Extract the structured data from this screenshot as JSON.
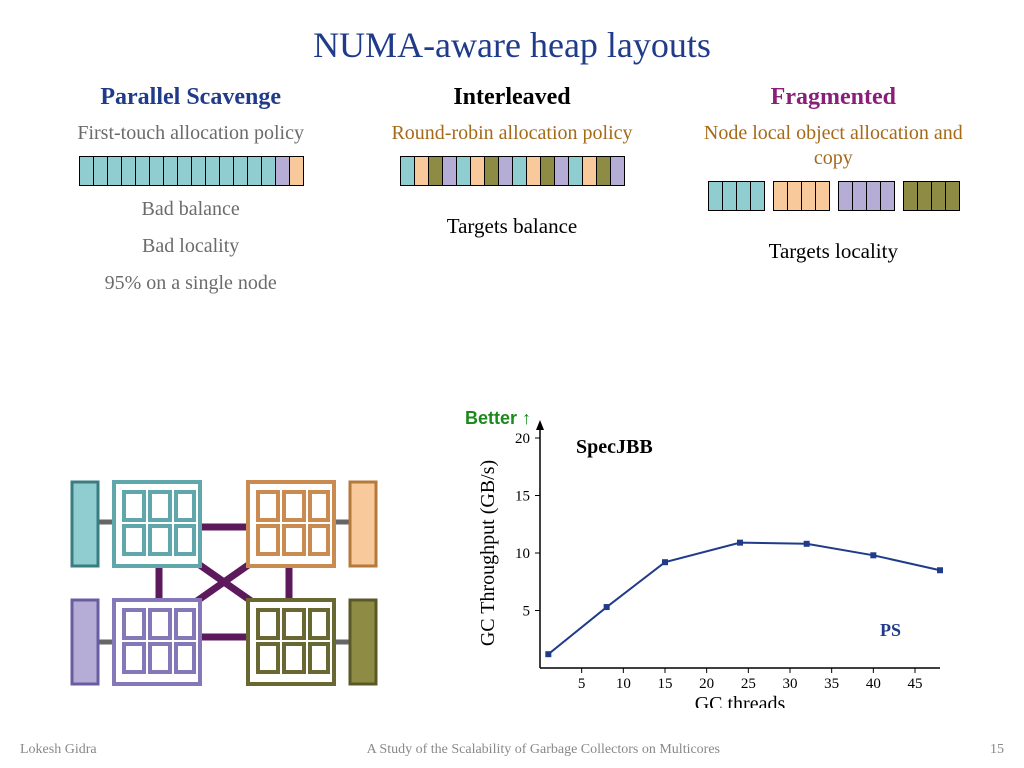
{
  "title": "NUMA-aware heap layouts",
  "columns": {
    "ps": {
      "title": "Parallel Scavenge",
      "title_color": "#1f3b8a",
      "sub": "First-touch allocation policy",
      "sub_color": "#6b6b6b",
      "notes": [
        "Bad balance",
        "Bad locality",
        "95% on a single node"
      ]
    },
    "int": {
      "title": "Interleaved",
      "title_color": "#000",
      "sub": "Round-robin allocation policy",
      "sub_color": "#a56a17",
      "target": "Targets balance"
    },
    "frg": {
      "title": "Fragmented",
      "title_color": "#8a1f7a",
      "sub": "Node local object allocation and copy",
      "sub_color": "#a56a17",
      "target": "Targets locality"
    }
  },
  "chart_data": {
    "type": "line",
    "title": "SpecJBB",
    "better_label": "Better ↑",
    "xlabel": "GC threads",
    "ylabel": "GC Throughput (GB/s)",
    "xlim": [
      0,
      48
    ],
    "xticks": [
      5,
      10,
      15,
      20,
      25,
      30,
      35,
      40,
      45
    ],
    "ylim": [
      0,
      20
    ],
    "yticks": [
      5,
      10,
      15,
      20
    ],
    "series": [
      {
        "name": "PS",
        "color": "#1f3b8a",
        "x": [
          1,
          8,
          15,
          24,
          32,
          40,
          48
        ],
        "y": [
          1.2,
          5.3,
          9.2,
          10.9,
          10.8,
          9.8,
          8.5
        ]
      }
    ]
  },
  "footer": {
    "author": "Lokesh Gidra",
    "paper": "A Study of the Scalability of Garbage Collectors on Multicores",
    "page": "15"
  }
}
